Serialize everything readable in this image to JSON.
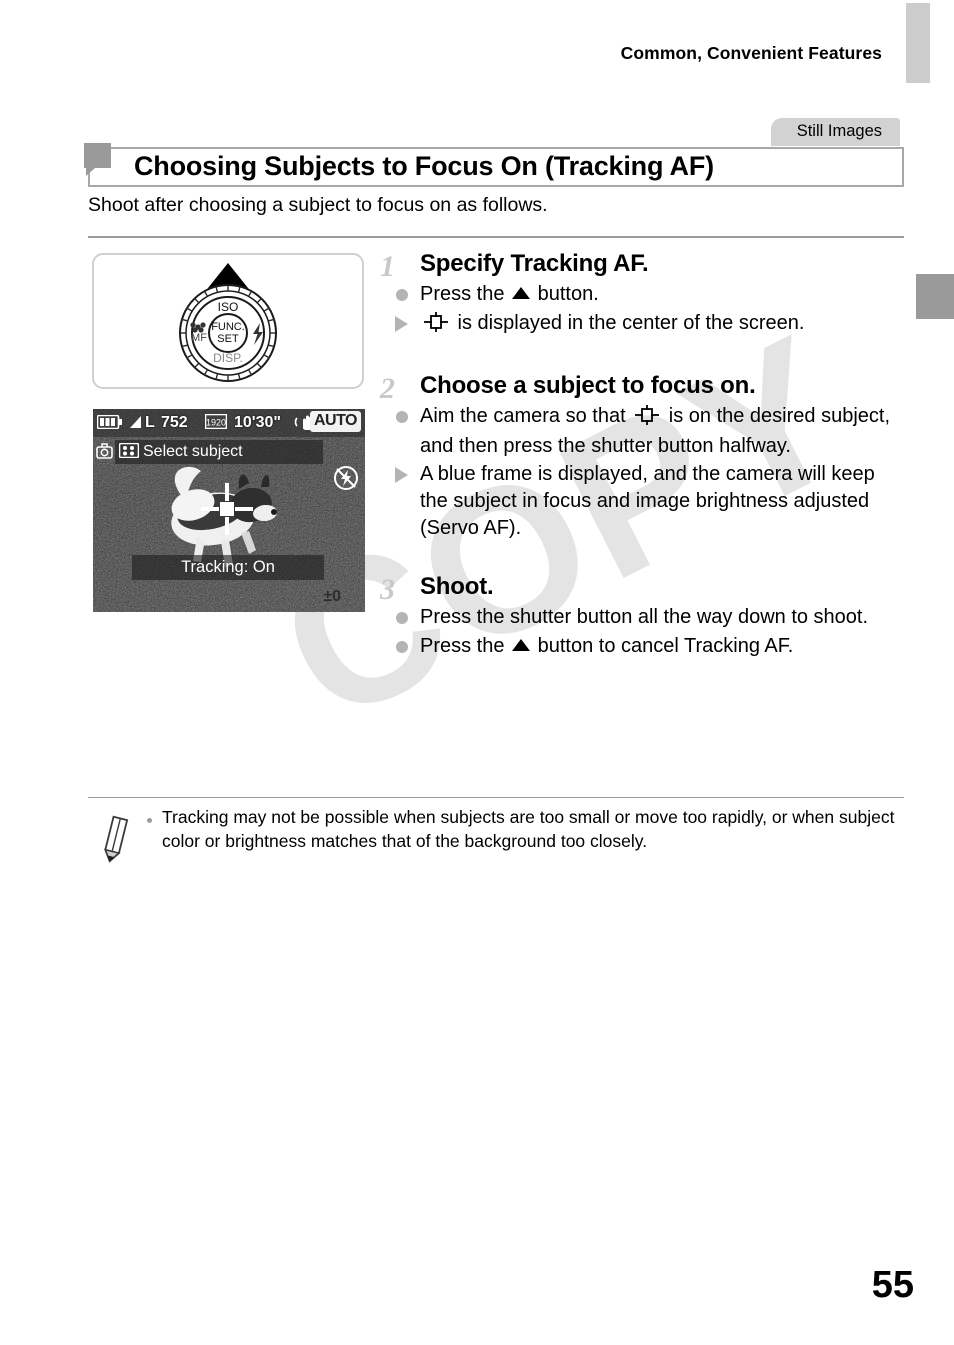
{
  "header": {
    "running_title": "Common, Convenient Features"
  },
  "edge_tabs": {
    "top_tab_color": "#cccccc",
    "active_tab_color": "#9a9a9a"
  },
  "section": {
    "category_tab": "Still Images",
    "heading": "Choosing Subjects to Focus On (Tracking AF)",
    "intro": "Shoot after choosing a subject to focus on as follows."
  },
  "figures": {
    "dial": {
      "caption_iso": "ISO",
      "caption_func": "FUNC.",
      "caption_set": "SET",
      "caption_disp": "DISP.",
      "caption_mf": "MF"
    },
    "lcd": {
      "quality": "L",
      "shots_remaining": "752",
      "movie_time": "10'30\"",
      "mode_badge": "AUTO",
      "select_subject_label": "Select subject",
      "tracking_label": "Tracking: On",
      "exposure_comp": "±0",
      "icons": [
        "battery-icon",
        "image-quality-icon",
        "movie-resolution-icon",
        "image-stabilizer-icon",
        "camera-shake-icon",
        "multi-select-icon",
        "flash-off-icon",
        "af-frame-crosshair-icon"
      ]
    }
  },
  "steps": [
    {
      "number": "1",
      "title": "Specify Tracking AF.",
      "bullets": [
        {
          "mark": "dot",
          "pre": "Press the ",
          "glyph": "up-triangle",
          "post": " button."
        },
        {
          "mark": "triangle",
          "pre": "",
          "glyph": "af-frame",
          "post": " is displayed in the center of the screen."
        }
      ]
    },
    {
      "number": "2",
      "title": "Choose a subject to focus on.",
      "bullets": [
        {
          "mark": "dot",
          "pre": "Aim the camera so that ",
          "glyph": "af-frame",
          "post": " is on the desired subject, and then press the shutter button halfway."
        },
        {
          "mark": "triangle",
          "pre": "A blue frame is displayed, and the camera will keep the subject in focus and image brightness adjusted (Servo AF).",
          "glyph": "none",
          "post": ""
        }
      ]
    },
    {
      "number": "3",
      "title": "Shoot.",
      "bullets": [
        {
          "mark": "dot",
          "pre": "Press the shutter button all the way down to shoot.",
          "glyph": "none",
          "post": ""
        },
        {
          "mark": "dot",
          "pre": "Press the ",
          "glyph": "up-triangle",
          "post": " button to cancel Tracking AF."
        }
      ]
    }
  ],
  "note": {
    "icon": "pencil-note-icon",
    "text": "Tracking may not be possible when subjects are too small or move too rapidly, or when subject color or brightness matches that of the background too closely."
  },
  "watermark": "COPY",
  "page_number": "55"
}
